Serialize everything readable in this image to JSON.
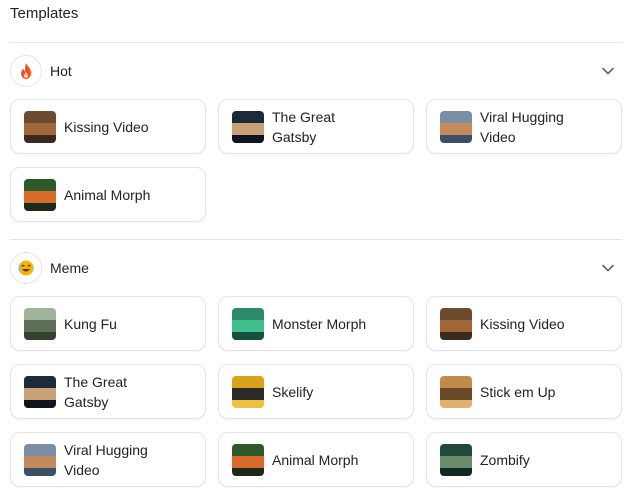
{
  "title": "Templates",
  "sections": [
    {
      "label": "Hot",
      "icon": "fire-icon",
      "icon_color": "#f4511e",
      "chevron": "chevron-down-icon",
      "cards": [
        {
          "label": "Kissing Video",
          "thumb": [
            "#6b4a2e",
            "#a0673b",
            "#3b2a1c"
          ]
        },
        {
          "label": "The Great Gatsby",
          "thumb": [
            "#1d2a3a",
            "#c9a27a",
            "#0e1520"
          ]
        },
        {
          "label": "Viral Hugging Video",
          "thumb": [
            "#7a8fa6",
            "#c58a5b",
            "#3a4f64"
          ]
        },
        {
          "label": "Animal Morph",
          "thumb": [
            "#2e5a2a",
            "#d86b2a",
            "#1c2a1a"
          ]
        }
      ]
    },
    {
      "label": "Meme",
      "icon": "laughing-emoji-icon",
      "icon_color": "#f5b400",
      "chevron": "chevron-down-icon",
      "cards": [
        {
          "label": "Kung Fu",
          "thumb": [
            "#9fb59a",
            "#5d6e57",
            "#34412f"
          ]
        },
        {
          "label": "Monster Morph",
          "thumb": [
            "#2a8a6a",
            "#3fbf8a",
            "#155040"
          ]
        },
        {
          "label": "Kissing Video",
          "thumb": [
            "#6b4a2e",
            "#a0673b",
            "#3b2a1c"
          ]
        },
        {
          "label": "The Great Gatsby",
          "thumb": [
            "#1d2a3a",
            "#c9a27a",
            "#0e1520"
          ]
        },
        {
          "label": "Skelify",
          "thumb": [
            "#d8a21a",
            "#2a2a2a",
            "#f0c040"
          ]
        },
        {
          "label": "Stick em Up",
          "thumb": [
            "#c08a4a",
            "#6a4a2a",
            "#e0b070"
          ]
        },
        {
          "label": "Viral Hugging Video",
          "thumb": [
            "#7a8fa6",
            "#c58a5b",
            "#3a4f64"
          ]
        },
        {
          "label": "Animal Morph",
          "thumb": [
            "#2e5a2a",
            "#d86b2a",
            "#1c2a1a"
          ]
        },
        {
          "label": "Zombify",
          "thumb": [
            "#1f4a3a",
            "#6a8a6a",
            "#0f2a20"
          ]
        }
      ]
    }
  ]
}
